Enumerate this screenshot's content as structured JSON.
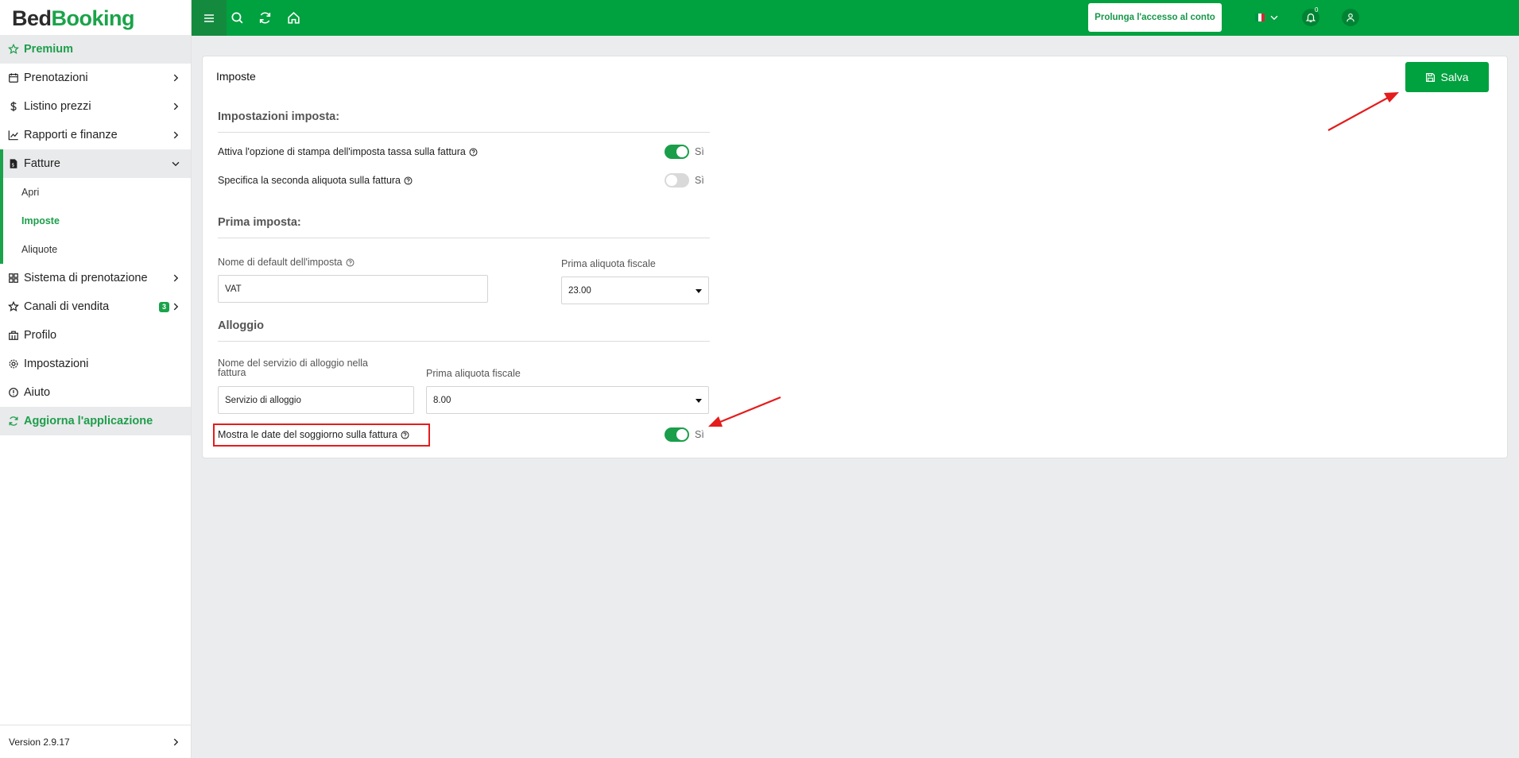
{
  "brand": {
    "part1": "Bed",
    "part2": "Booking"
  },
  "sidebar": {
    "items": [
      {
        "label": "Premium"
      },
      {
        "label": "Prenotazioni"
      },
      {
        "label": "Listino prezzi"
      },
      {
        "label": "Rapporti e finanze"
      },
      {
        "label": "Fatture"
      },
      {
        "label": "Apri"
      },
      {
        "label": "Imposte"
      },
      {
        "label": "Aliquote"
      },
      {
        "label": "Sistema di prenotazione"
      },
      {
        "label": "Canali di vendita",
        "badge": "3"
      },
      {
        "label": "Profilo"
      },
      {
        "label": "Impostazioni"
      },
      {
        "label": "Aiuto"
      },
      {
        "label": "Aggiorna l'applicazione"
      }
    ],
    "version": "Version 2.9.17"
  },
  "topbar": {
    "extend_access_label": "Prolunga l'accesso al conto",
    "notifications_count": "0"
  },
  "card": {
    "title": "Imposte",
    "save_label": "Salva",
    "tax_settings": {
      "heading": "Impostazioni imposta:",
      "print_tax_label": "Attiva l'opzione di stampa dell'imposta tassa sulla fattura",
      "print_tax_state": "Sì",
      "second_rate_label": "Specifica la seconda aliquota sulla fattura",
      "second_rate_state": "Sì"
    },
    "first_tax": {
      "heading": "Prima imposta:",
      "default_name_label": "Nome di default dell'imposta",
      "default_name_value": "VAT",
      "rate_label": "Prima aliquota fiscale",
      "rate_value": "23.00"
    },
    "accommodation": {
      "heading": "Alloggio",
      "service_name_label_line1": "Nome del servizio di alloggio nella",
      "service_name_label_line2": "fattura",
      "service_name_value": "Servizio di alloggio",
      "rate_label": "Prima aliquota fiscale",
      "rate_value": "8.00",
      "show_dates_label": "Mostra le date del soggiorno sulla fattura",
      "show_dates_state": "Sì"
    }
  },
  "colors": {
    "brand_green": "#00a13f",
    "annotation_red": "#e41c1c"
  }
}
